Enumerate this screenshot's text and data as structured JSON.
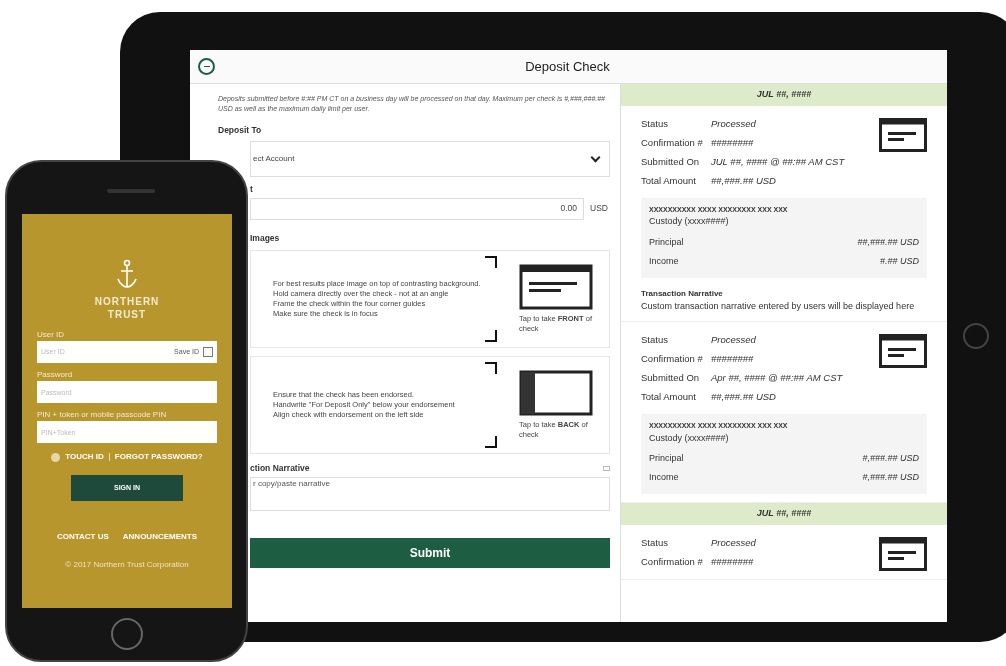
{
  "tablet": {
    "title": "Deposit Check",
    "intro": "Deposits submitted before #:## PM CT on a business day will be processed on that day. Maximum per check is #,###,###.## USD as well as the maximum daily limit per user.",
    "deposit_to": {
      "label": "Deposit To",
      "value": "ect Account"
    },
    "amount": {
      "label": "t",
      "value": "0.00",
      "currency": "USD"
    },
    "images_label": "Images",
    "captures": [
      {
        "kind": "front",
        "lines": [
          "For best results place image on top of contrasting background.",
          "Hold camera directly over the check - not at an angle",
          "Frame the check within the four corner guides",
          "Make sure the check is in focus"
        ],
        "caption": "Tap to take **FRONT** of check"
      },
      {
        "kind": "back",
        "lines": [
          "Ensure that the check has been endorsed.",
          "Handwrite \"For Deposit Only\" below your endorsement",
          "Align check with endorsement on the left side"
        ],
        "caption": "Tap to take **BACK** of check"
      }
    ],
    "narrative": {
      "label": "ction Narrative",
      "placeholder": "r copy/paste narrative"
    },
    "submit": "Submit",
    "history": [
      {
        "date": "JUL ##, ####",
        "rows": [
          {
            "label": "Status",
            "value": "Processed"
          },
          {
            "label": "Confirmation #",
            "value": "########"
          },
          {
            "label": "Submitted On",
            "value": "JUL ##, #### @ ##:## AM CST"
          },
          {
            "label": "Total Amount",
            "value": "##,###.## USD"
          }
        ],
        "account": "XXXXXXXXXX XXXX XXXXXXXX XXX XXX",
        "custody": "Custody (xxxx####)",
        "amounts": [
          {
            "label": "Principal",
            "value": "##,###.## USD"
          },
          {
            "label": "Income",
            "value": "#.## USD"
          }
        ],
        "narrative_label": "Transaction Narrative",
        "narrative": "Custom transaction narrative entered by users will be displayed here"
      },
      {
        "rows": [
          {
            "label": "Status",
            "value": "Processed"
          },
          {
            "label": "Confirmation #",
            "value": "########"
          },
          {
            "label": "Submitted On",
            "value": "Apr ##, #### @ ##:## AM CST"
          },
          {
            "label": "Total Amount",
            "value": "##,###.## USD"
          }
        ],
        "account": "XXXXXXXXXX XXXX XXXXXXXX XXX XXX",
        "custody": "Custody (xxxx####)",
        "amounts": [
          {
            "label": "Principal",
            "value": "#,###.## USD"
          },
          {
            "label": "Income",
            "value": "#,###.## USD"
          }
        ]
      },
      {
        "date": "JUL ##, ####",
        "rows": [
          {
            "label": "Status",
            "value": "Processed"
          },
          {
            "label": "Confirmation #",
            "value": "########"
          }
        ]
      }
    ]
  },
  "phone": {
    "brand": [
      "NORTHERN",
      "TRUST"
    ],
    "user_id": {
      "label": "User ID",
      "placeholder": "User ID",
      "save_label": "Save ID",
      "save_checked": false
    },
    "password": {
      "label": "Password",
      "placeholder": "Password"
    },
    "pin": {
      "label": "PIN + token or mobile passcode PIN",
      "placeholder": "PIN+Token"
    },
    "links": [
      "TOUCH ID",
      "FORGOT PASSWORD?"
    ],
    "sign_in": "SIGN IN",
    "footer_links": [
      "CONTACT US",
      "ANNOUNCEMENTS"
    ],
    "copyright": "© 2017 Northern Trust Corporation"
  }
}
